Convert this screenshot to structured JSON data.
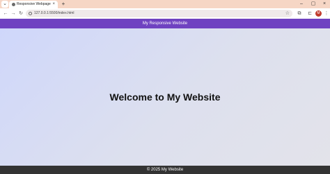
{
  "browser": {
    "tab_title": "Responsive Webpage",
    "tab_close": "×",
    "new_tab": "+",
    "url": "127.0.0.1:5500/index.html",
    "avatar_initial": "M",
    "icons": {
      "back": "←",
      "forward": "→",
      "reload": "↻",
      "star": "☆",
      "extensions": "⧉",
      "menu": "⋮",
      "minimize": "–",
      "maximize": "▢",
      "close": "×"
    }
  },
  "site": {
    "header_title": "My Responsive Website",
    "heading": "Welcome to My Website",
    "footer": "© 2025 My Website"
  },
  "colors": {
    "header": "#6f42c1",
    "footer": "#333333",
    "gradient_start": "#cfd7fb",
    "gradient_end": "#e3e3ea"
  }
}
